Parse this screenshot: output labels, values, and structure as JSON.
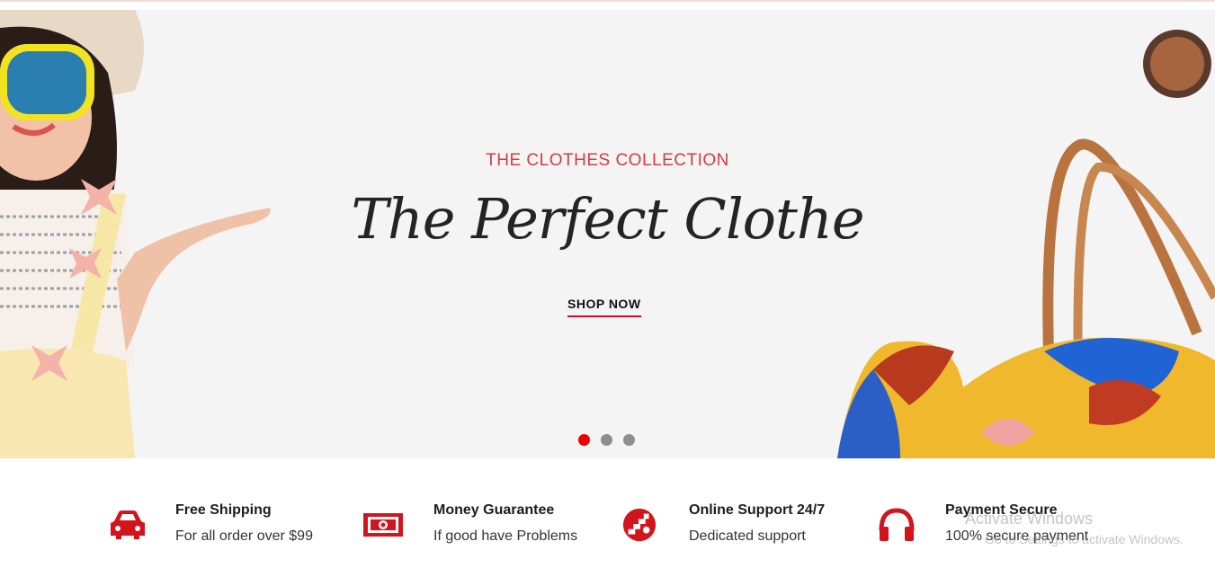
{
  "hero": {
    "eyebrow": "THE CLOTHES COLLECTION",
    "headline": "The Perfect Clothe",
    "cta_label": "SHOP NOW",
    "slides": [
      {
        "active": true
      },
      {
        "active": false
      },
      {
        "active": false
      }
    ]
  },
  "features": [
    {
      "icon": "car-icon",
      "title": "Free Shipping",
      "subtitle": "For all order over $99"
    },
    {
      "icon": "money-icon",
      "title": "Money Guarantee",
      "subtitle": "If good have Problems"
    },
    {
      "icon": "support-icon",
      "title": "Online Support 24/7",
      "subtitle": "Dedicated support"
    },
    {
      "icon": "headphones-icon",
      "title": "Payment Secure",
      "subtitle": "100% secure payment"
    }
  ],
  "watermark": {
    "title": "Activate Windows",
    "subtitle": "Go to Settings to activate Windows."
  },
  "colors": {
    "accent": "#c8102e",
    "eyebrow": "#d43b42",
    "dot_active": "#ee0000",
    "dot_inactive": "#8e8e8e"
  }
}
